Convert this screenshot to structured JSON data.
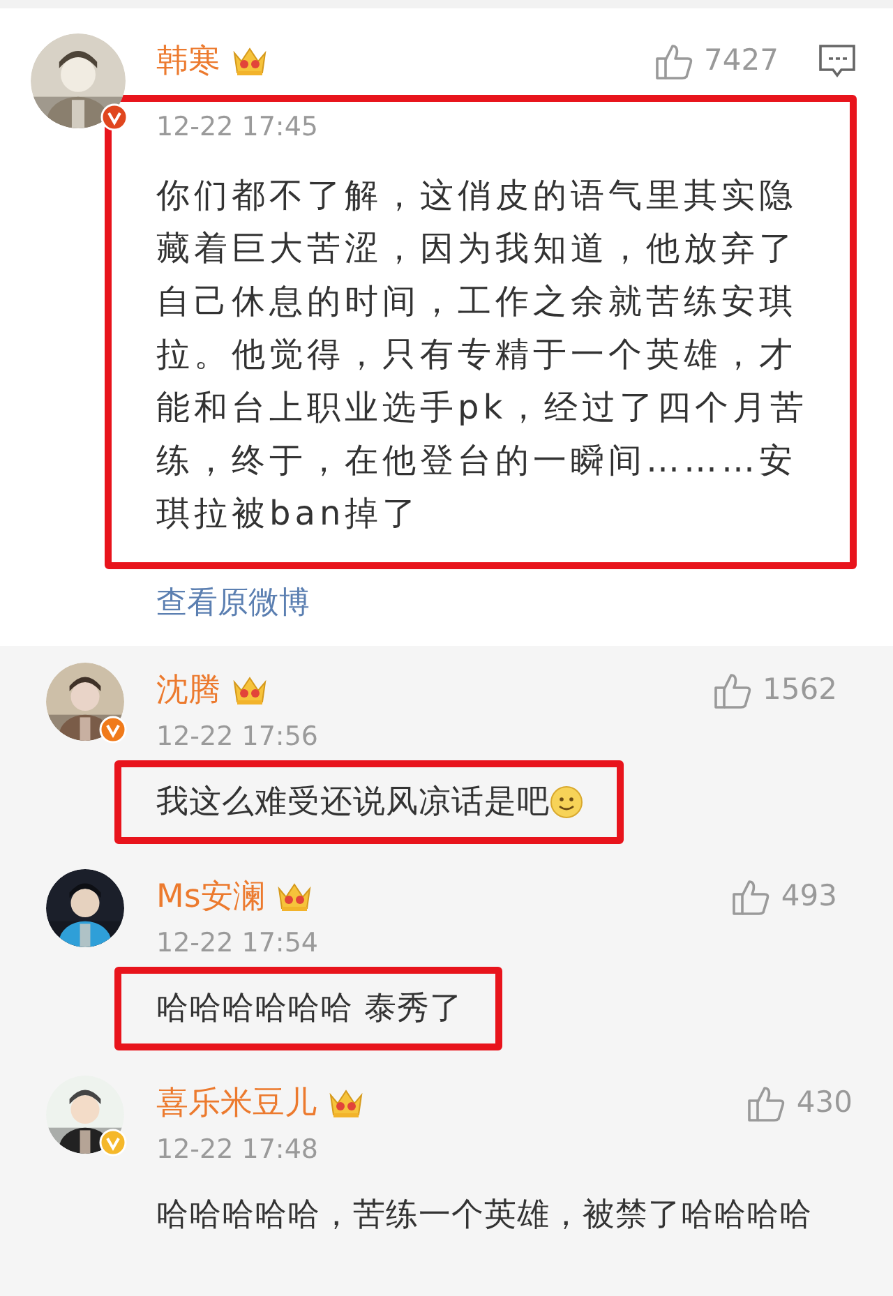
{
  "main_comment": {
    "name": "韩寒",
    "badge": {
      "color": "#e0461e"
    },
    "likes": "7427",
    "time": "12-22 17:45",
    "text": "你们都不了解，这俏皮的语气里其实隐藏着巨大苦涩，因为我知道，他放弃了自己休息的时间，工作之余就苦练安琪拉。他觉得，只有专精于一个英雄，才能和台上职业选手pk，经过了四个月苦练，终于，在他登台的一瞬间………安琪拉被ban掉了",
    "highlighted": true,
    "link": "查看原微博"
  },
  "replies": [
    {
      "name": "沈腾",
      "badge": {
        "color": "#f07a1a"
      },
      "likes": "1562",
      "time": "12-22 17:56",
      "text": "我这么难受还说风凉话是吧",
      "emoji": true,
      "highlighted": true
    },
    {
      "name": "Ms安澜",
      "likes": "493",
      "time": "12-22 17:54",
      "text": "哈哈哈哈哈哈 泰秀了",
      "emoji": false,
      "highlighted": true
    },
    {
      "name": "喜乐米豆儿",
      "badge": {
        "color": "#f5b82a"
      },
      "likes": "430",
      "time": "12-22 17:48",
      "text": "哈哈哈哈哈，苦练一个英雄，被禁了哈哈哈哈",
      "emoji": false,
      "highlighted": false
    }
  ]
}
